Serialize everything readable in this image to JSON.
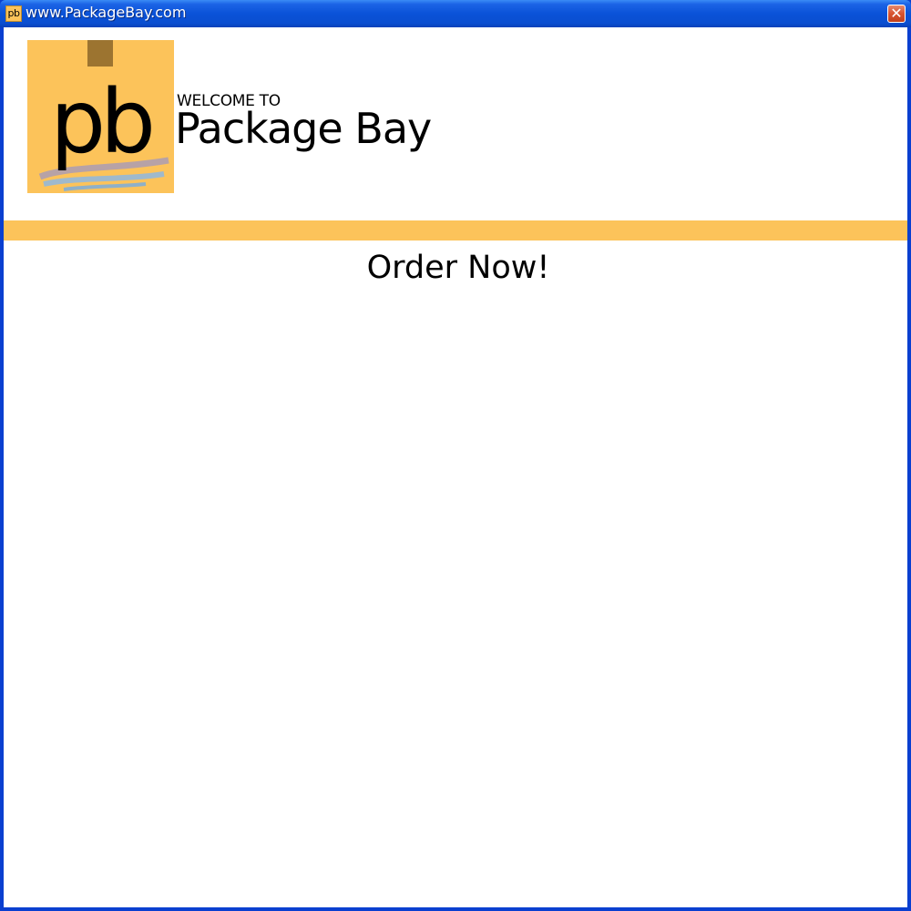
{
  "window": {
    "title": "www.PackageBay.com",
    "icon_text": "pb",
    "close_label": "✕"
  },
  "header": {
    "logo_text": "pb",
    "welcome": "WELCOME TO",
    "brand": "Package Bay"
  },
  "main": {
    "heading": "Order Now!"
  },
  "colors": {
    "accent": "#fcc35a",
    "titlebar": "#0a52d8",
    "logo_tab": "#9c7430"
  }
}
